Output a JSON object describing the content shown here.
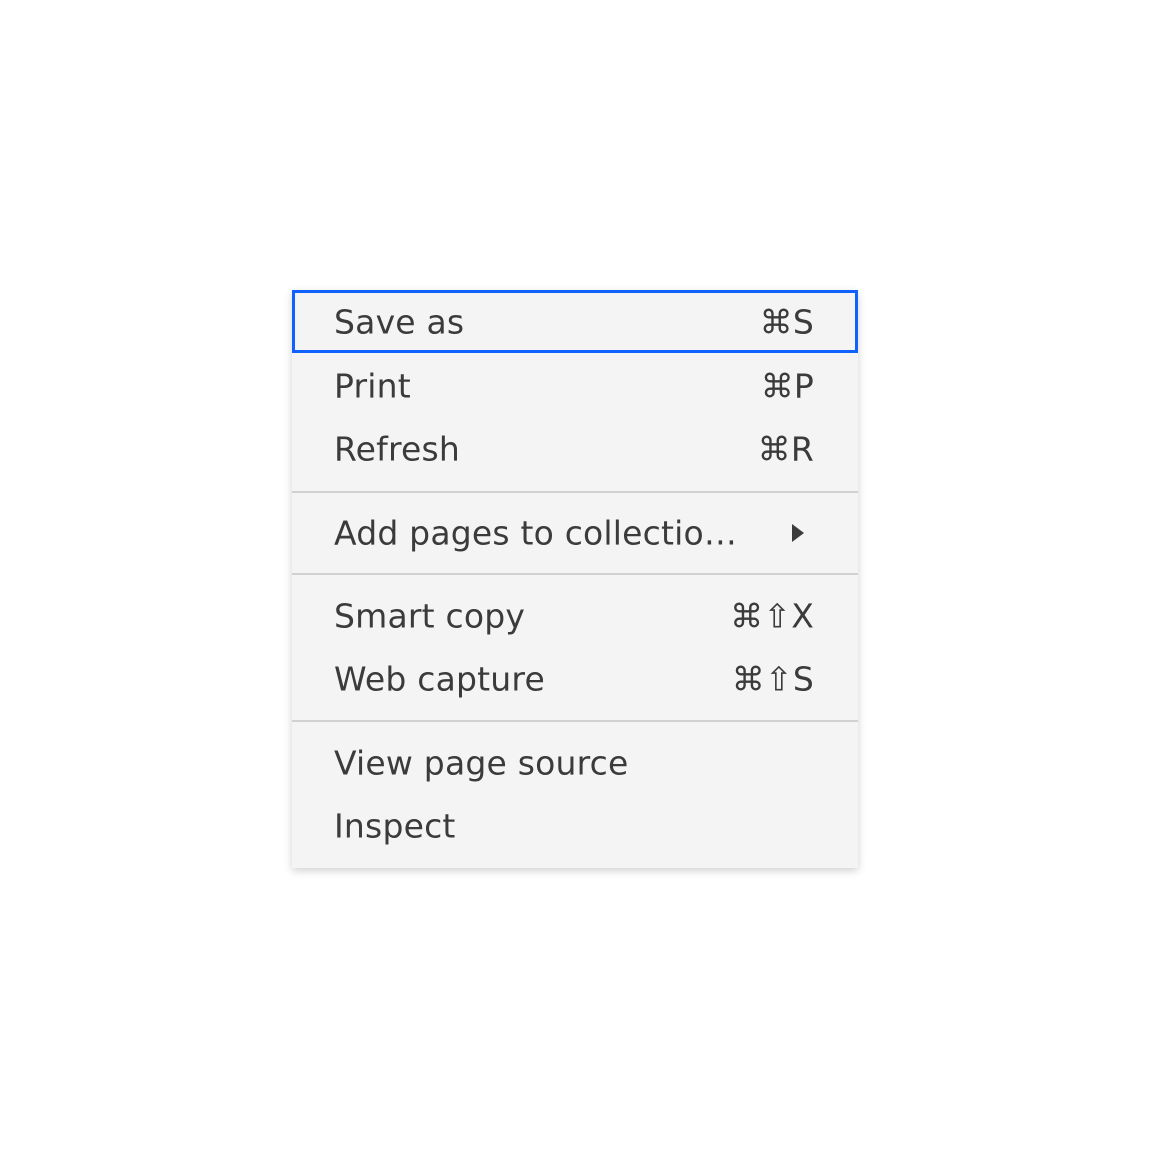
{
  "menu": {
    "items": [
      {
        "label": "Save as",
        "shortcut": "⌘S"
      },
      {
        "label": "Print",
        "shortcut": "⌘P"
      },
      {
        "label": "Refresh",
        "shortcut": "⌘R"
      },
      {
        "label": "Add pages to collectio…",
        "submenu": true
      },
      {
        "label": "Smart copy",
        "shortcut": "⌘⇧X"
      },
      {
        "label": "Web capture",
        "shortcut": "⌘⇧S"
      },
      {
        "label": "View page source"
      },
      {
        "label": "Inspect"
      }
    ]
  },
  "colors": {
    "menu_bg": "#f4f4f4",
    "text": "#3b3b3b",
    "focus_border": "#0f62fe",
    "divider": "#d1d1d1"
  }
}
